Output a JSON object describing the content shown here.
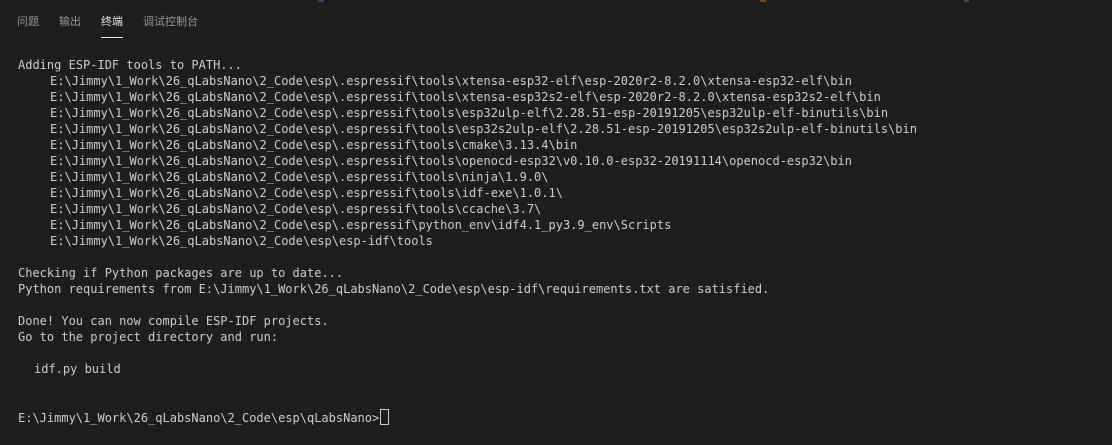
{
  "panel": {
    "tabs": [
      {
        "label": "问题"
      },
      {
        "label": "输出"
      },
      {
        "label": "终端"
      },
      {
        "label": "调试控制台"
      }
    ],
    "active_tab": "终端"
  },
  "colors": {
    "background": "#1e1e1e",
    "text": "#cccccc",
    "tab_inactive": "#969696",
    "tab_active": "#e7e7e7"
  },
  "terminal": {
    "header": "Adding ESP-IDF tools to PATH...",
    "paths": [
      "E:\\Jimmy\\1_Work\\26_qLabsNano\\2_Code\\esp\\.espressif\\tools\\xtensa-esp32-elf\\esp-2020r2-8.2.0\\xtensa-esp32-elf\\bin",
      "E:\\Jimmy\\1_Work\\26_qLabsNano\\2_Code\\esp\\.espressif\\tools\\xtensa-esp32s2-elf\\esp-2020r2-8.2.0\\xtensa-esp32s2-elf\\bin",
      "E:\\Jimmy\\1_Work\\26_qLabsNano\\2_Code\\esp\\.espressif\\tools\\esp32ulp-elf\\2.28.51-esp-20191205\\esp32ulp-elf-binutils\\bin",
      "E:\\Jimmy\\1_Work\\26_qLabsNano\\2_Code\\esp\\.espressif\\tools\\esp32s2ulp-elf\\2.28.51-esp-20191205\\esp32s2ulp-elf-binutils\\bin",
      "E:\\Jimmy\\1_Work\\26_qLabsNano\\2_Code\\esp\\.espressif\\tools\\cmake\\3.13.4\\bin",
      "E:\\Jimmy\\1_Work\\26_qLabsNano\\2_Code\\esp\\.espressif\\tools\\openocd-esp32\\v0.10.0-esp32-20191114\\openocd-esp32\\bin",
      "E:\\Jimmy\\1_Work\\26_qLabsNano\\2_Code\\esp\\.espressif\\tools\\ninja\\1.9.0\\",
      "E:\\Jimmy\\1_Work\\26_qLabsNano\\2_Code\\esp\\.espressif\\tools\\idf-exe\\1.0.1\\",
      "E:\\Jimmy\\1_Work\\26_qLabsNano\\2_Code\\esp\\.espressif\\tools\\ccache\\3.7\\",
      "E:\\Jimmy\\1_Work\\26_qLabsNano\\2_Code\\esp\\.espressif\\python_env\\idf4.1_py3.9_env\\Scripts",
      "E:\\Jimmy\\1_Work\\26_qLabsNano\\2_Code\\esp\\esp-idf\\tools"
    ],
    "check_line": "Checking if Python packages are up to date...",
    "requirements_line": "Python requirements from E:\\Jimmy\\1_Work\\26_qLabsNano\\2_Code\\esp\\esp-idf\\requirements.txt are satisfied.",
    "done_line": "Done! You can now compile ESP-IDF projects.",
    "goto_line": "Go to the project directory and run:",
    "command_line": "idf.py build",
    "prompt": "E:\\Jimmy\\1_Work\\26_qLabsNano\\2_Code\\esp\\qLabsNano>"
  }
}
